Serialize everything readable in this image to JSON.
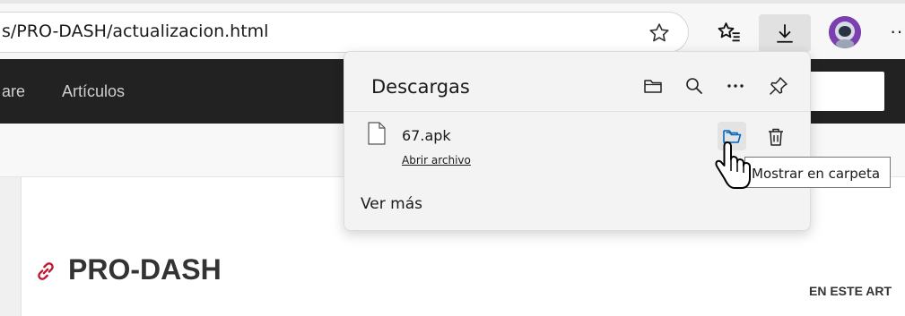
{
  "browser": {
    "url": "s/PRO-DASH/actualizacion.html",
    "icons": {
      "favorite": "star-icon",
      "favorites_bar": "favorites-icon",
      "downloads": "download-icon",
      "profile": "avatar",
      "more": "more-icon"
    },
    "more_label": "···"
  },
  "site": {
    "nav_items": [
      "are",
      "Artículos"
    ],
    "article_title": "PRO-DASH",
    "toc_label": "EN ESTE ART",
    "colors": {
      "nav_bg": "#222222",
      "link_icon": "#c0152f"
    }
  },
  "downloads_panel": {
    "title": "Descargas",
    "file": {
      "name": "67.apk",
      "action_label": "Abrir archivo"
    },
    "see_more": "Ver más",
    "tooltip": "Mostrar en carpeta",
    "accent": "#0067c0"
  }
}
